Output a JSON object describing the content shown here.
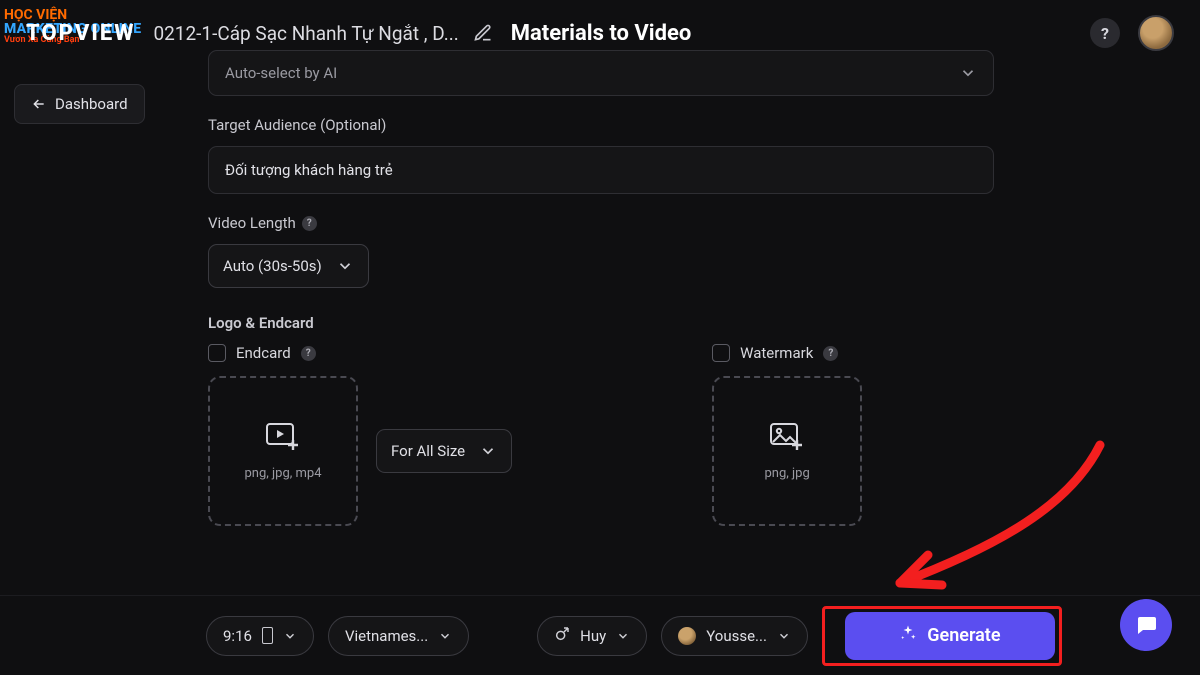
{
  "watermark": {
    "line1": "HỌC VIỆN",
    "line2": "MARKETING ONLINE",
    "line3": "Vươn Xa Cùng Bạn"
  },
  "header": {
    "logo": "TOPVIEW",
    "project_name": "0212-1-Cáp Sạc Nhanh Tự Ngắt , D...",
    "page_title": "Materials to Video"
  },
  "nav": {
    "dashboard": "Dashboard"
  },
  "form": {
    "ai_select": {
      "value": "Auto-select by AI"
    },
    "audience": {
      "label": "Target Audience (Optional)",
      "value": "Đối tượng khách hàng trẻ"
    },
    "video_length": {
      "label": "Video Length",
      "value": "Auto (30s-50s)"
    },
    "logo_endcard": {
      "section_label": "Logo & Endcard",
      "endcard": {
        "label": "Endcard",
        "formats": "png, jpg, mp4",
        "size_option": "For All Size"
      },
      "watermark": {
        "label": "Watermark",
        "formats": "png, jpg"
      }
    }
  },
  "bottom_bar": {
    "aspect": "9:16",
    "language": "Vietnames...",
    "voice": "Huy",
    "avatar_model": "Yousse...",
    "generate": "Generate"
  }
}
